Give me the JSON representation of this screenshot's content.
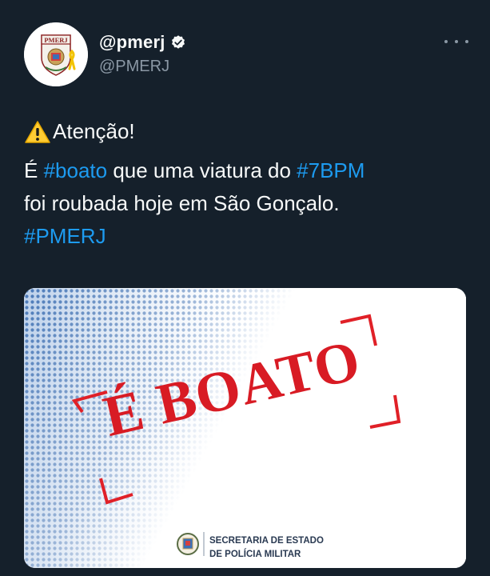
{
  "header": {
    "avatar_text": "PMERJ",
    "display_name": "@pmerj",
    "handle": "@PMERJ",
    "verified_icon": "verified-badge",
    "more_icon": "more-dots"
  },
  "tweet": {
    "attention_icon": "warning-icon",
    "attention": "Atenção!",
    "line1_prefix": "É ",
    "hashtag_boato": "#boato",
    "line1_middle": " que uma viatura do ",
    "hashtag_7bpm": "#7BPM",
    "line2": "foi roubada hoje em São Gonçalo.",
    "hashtag_pmerj": "#PMERJ"
  },
  "media": {
    "stamp": "É BOATO",
    "org_line1": "SECRETARIA DE ESTADO",
    "org_line2": "DE POLÍCIA MILITAR"
  },
  "colors": {
    "background": "#15202b",
    "hashtag": "#1d9bf0",
    "stamp": "#d81b24",
    "handle": "#8b98a5"
  }
}
